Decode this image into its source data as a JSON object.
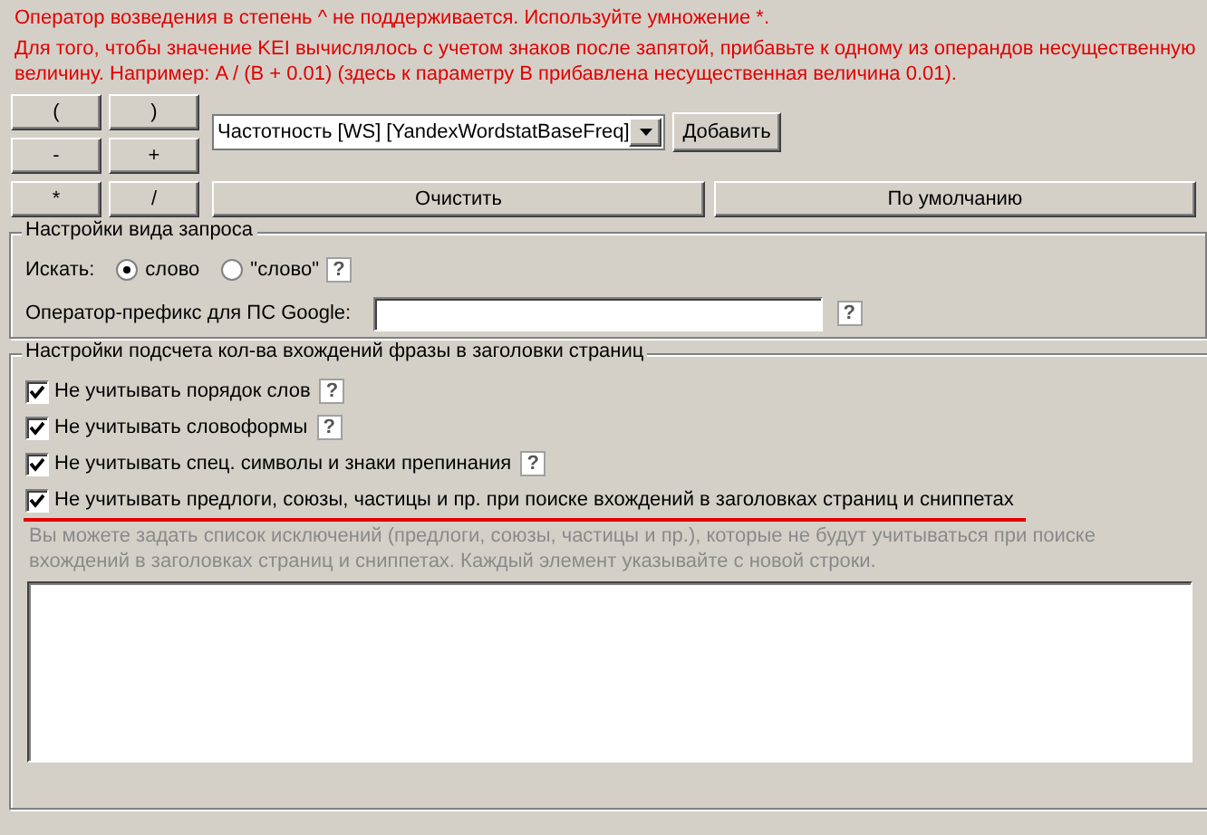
{
  "notices": [
    "Оператор возведения в степень ^ не поддерживается. Используйте умножение *.",
    "Для того, чтобы значение KEI вычислялось с учетом знаков после запятой, прибавьте к одному из операндов несущественную величину. Например: A / (B + 0.01) (здесь к параметру B прибавлена несущественная величина 0.01)."
  ],
  "operator_buttons": [
    "(",
    ")",
    "-",
    "+",
    "*",
    "/"
  ],
  "field_select": {
    "value": "Частотность [WS] [YandexWordstatBaseFreq]"
  },
  "add_button": "Добавить",
  "clear_button": "Очистить",
  "default_button": "По умолчанию",
  "query_group": {
    "title": "Настройки вида запроса",
    "search_label": "Искать:",
    "search_options": [
      {
        "label": "слово",
        "selected": true
      },
      {
        "label": "\"слово\"",
        "selected": false
      }
    ],
    "search_help": "?",
    "prefix_label": "Оператор-префикс для ПС Google:",
    "prefix_help": "?"
  },
  "count_group": {
    "title": "Настройки подсчета кол-ва вхождений фразы в заголовки страниц",
    "options": [
      {
        "label": "Не учитывать порядок слов",
        "checked": true,
        "help": "?"
      },
      {
        "label": "Не учитывать словоформы",
        "checked": true,
        "help": "?"
      },
      {
        "label": "Не учитывать спец. символы и знаки препинания",
        "checked": true,
        "help": "?"
      },
      {
        "label": "Не учитывать предлоги, союзы, частицы и пр. при поиске вхождений в заголовках страниц и сниппетах",
        "checked": true,
        "underlined": true
      }
    ],
    "hint": "Вы можете задать список исключений (предлоги, союзы, частицы и пр.), которые не будут учитываться при поиске вхождений в заголовках страниц и сниппетах. Каждый элемент указывайте с новой строки."
  }
}
